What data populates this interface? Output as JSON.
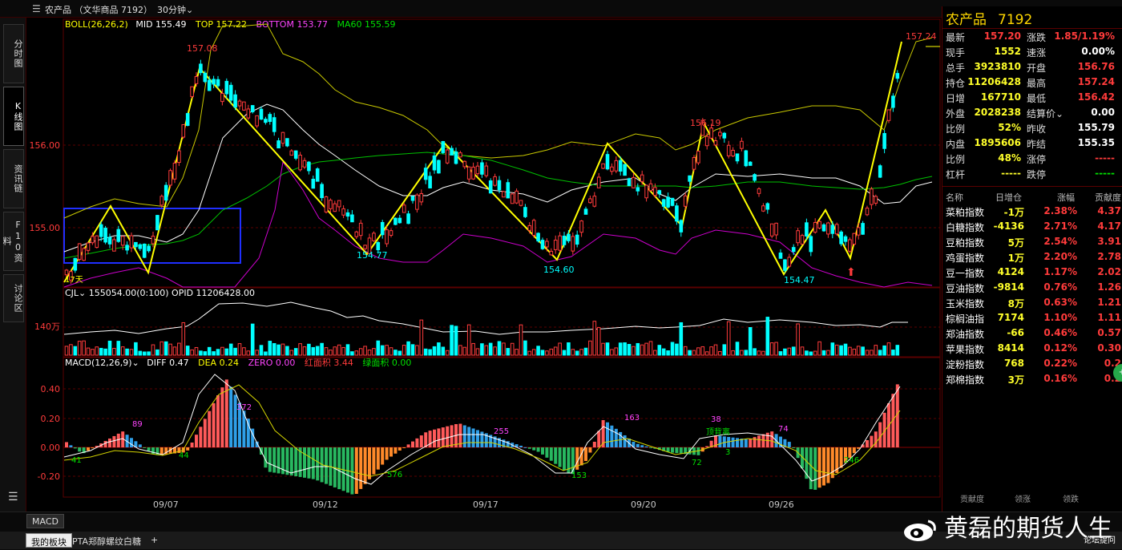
{
  "titlebar": {
    "title": "农产品 （文华商品 7192）",
    "period": "30分钟⌄"
  },
  "left_tabs": [
    "分时图",
    "K线图",
    "资讯链",
    "F10资料",
    "讨论区"
  ],
  "main": {
    "legend": {
      "name": "BOLL(26,26,2)",
      "mid": "MID 155.49",
      "top": "TOP 157.22",
      "bottom": "BOTTOM 153.77",
      "ma60": "MA60 155.59"
    },
    "y_labels": [
      "156.00",
      "155.00"
    ],
    "annotations": {
      "a1": "157.08",
      "a2": "154.77",
      "a3": "154.60",
      "a4": "156.19",
      "a5": "154.47",
      "a6": "157.24",
      "a7": "17天"
    }
  },
  "volume": {
    "legend": "CJL⌄  155054.00(0:100)   OPID 11206428.00",
    "y_label": "140万"
  },
  "macd": {
    "legend_name": "MACD(12,26,9)⌄",
    "diff": "DIFF 0.47",
    "dea": "DEA 0.24",
    "zero": "ZERO 0.00",
    "red": "红面积 3.44",
    "green": "绿面积 0.00",
    "y_labels": [
      "0.40",
      "0.20",
      "0.00",
      "-0.20"
    ],
    "labels": [
      "89",
      "41",
      "44",
      "372",
      "576",
      "255",
      "153",
      "163",
      "38",
      "72",
      "3",
      "顶背离",
      "74",
      "246"
    ]
  },
  "x_labels": [
    "09/07",
    "09/12",
    "09/17",
    "09/20",
    "09/26"
  ],
  "colors": {
    "up": "#ff3b3b",
    "down": "#00ffff",
    "bg": "#000000",
    "grid": "#5a0000",
    "zz": "#ffff00",
    "ma60": "#00c000",
    "mid": "#ffffff",
    "top": "#c8c800",
    "bottom": "#cc00cc",
    "box": "#1f2fff"
  },
  "bottom": {
    "macd_tab": "MACD",
    "tabs": [
      "我的板块",
      "PTA郑醇螺纹白糖",
      "+"
    ],
    "watermark": "黄磊的期货人生",
    "forum": "论坛提问"
  },
  "quote": {
    "name": "农产品",
    "code": "7192",
    "rows": [
      [
        "最新",
        "157.20",
        "涨跌",
        "1.85/1.19%"
      ],
      [
        "现手",
        "1552",
        "速涨",
        "0.00%"
      ],
      [
        "总手",
        "3923810",
        "开盘",
        "156.76"
      ],
      [
        "持仓",
        "11206428",
        "最高",
        "157.24"
      ],
      [
        "日增",
        "167710",
        "最低",
        "156.42"
      ],
      [
        "外盘",
        "2028238",
        "结算价⌄",
        "0.00"
      ],
      [
        "比例",
        "52%",
        "昨收",
        "155.79"
      ],
      [
        "内盘",
        "1895606",
        "昨结",
        "155.35"
      ],
      [
        "比例",
        "48%",
        "涨停",
        "-----"
      ],
      [
        "杠杆",
        "-----",
        "跌停",
        "-----"
      ]
    ]
  },
  "index_table": {
    "headers": [
      "名称",
      "日增仓",
      "涨幅",
      "贡献度"
    ],
    "rows": [
      [
        "菜粕指数",
        "-1万",
        "2.38%",
        "4.37"
      ],
      [
        "白糖指数",
        "-4136",
        "2.71%",
        "4.17"
      ],
      [
        "豆粕指数",
        "5万",
        "2.54%",
        "3.91"
      ],
      [
        "鸡蛋指数",
        "1万",
        "2.20%",
        "2.78"
      ],
      [
        "豆一指数",
        "4124",
        "1.17%",
        "2.02"
      ],
      [
        "豆油指数",
        "-9814",
        "0.76%",
        "1.26"
      ],
      [
        "玉米指数",
        "8万",
        "0.63%",
        "1.21"
      ],
      [
        "棕榈油指",
        "7174",
        "1.10%",
        "1.11"
      ],
      [
        "郑油指数",
        "-66",
        "0.46%",
        "0.57"
      ],
      [
        "苹果指数",
        "8414",
        "0.12%",
        "0.30"
      ],
      [
        "淀粉指数",
        "768",
        "0.22%",
        "0.2"
      ],
      [
        "郑棉指数",
        "3万",
        "0.16%",
        "0.2"
      ]
    ],
    "footer": [
      "贡献度",
      "领涨",
      "领跌"
    ]
  }
}
